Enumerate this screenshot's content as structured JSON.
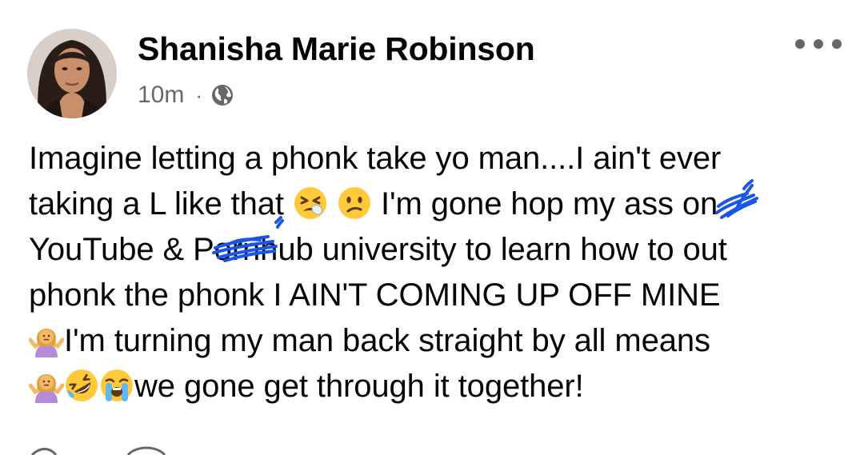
{
  "post": {
    "author": "Shanisha Marie Robinson",
    "timestamp": "10m",
    "separator": "·",
    "audience_icon": "globe-icon",
    "more_icon": "more-options-icon",
    "lines": [
      [
        "Imagine letting a phonk take yo man....I ain't ever"
      ],
      [
        "taking a L like that ",
        " ",
        " I'm gone hop my ass on"
      ],
      [
        "YouTube & Pornhub  university to learn how to out"
      ],
      [
        "phonk the phonk I AIN'T COMING UP OFF MINE"
      ],
      [
        "I'm turning my man back straight by all means"
      ],
      [
        "we gone get through it together!"
      ]
    ],
    "emojis": [
      "tired-face-emoji",
      "confused-face-emoji",
      "person-shrugging-emoji",
      "rolling-laughing-emoji",
      "loudly-crying-emoji"
    ],
    "colors": {
      "text": "#050505",
      "secondary": "#65676b",
      "scribble": "#1a56e8"
    }
  }
}
